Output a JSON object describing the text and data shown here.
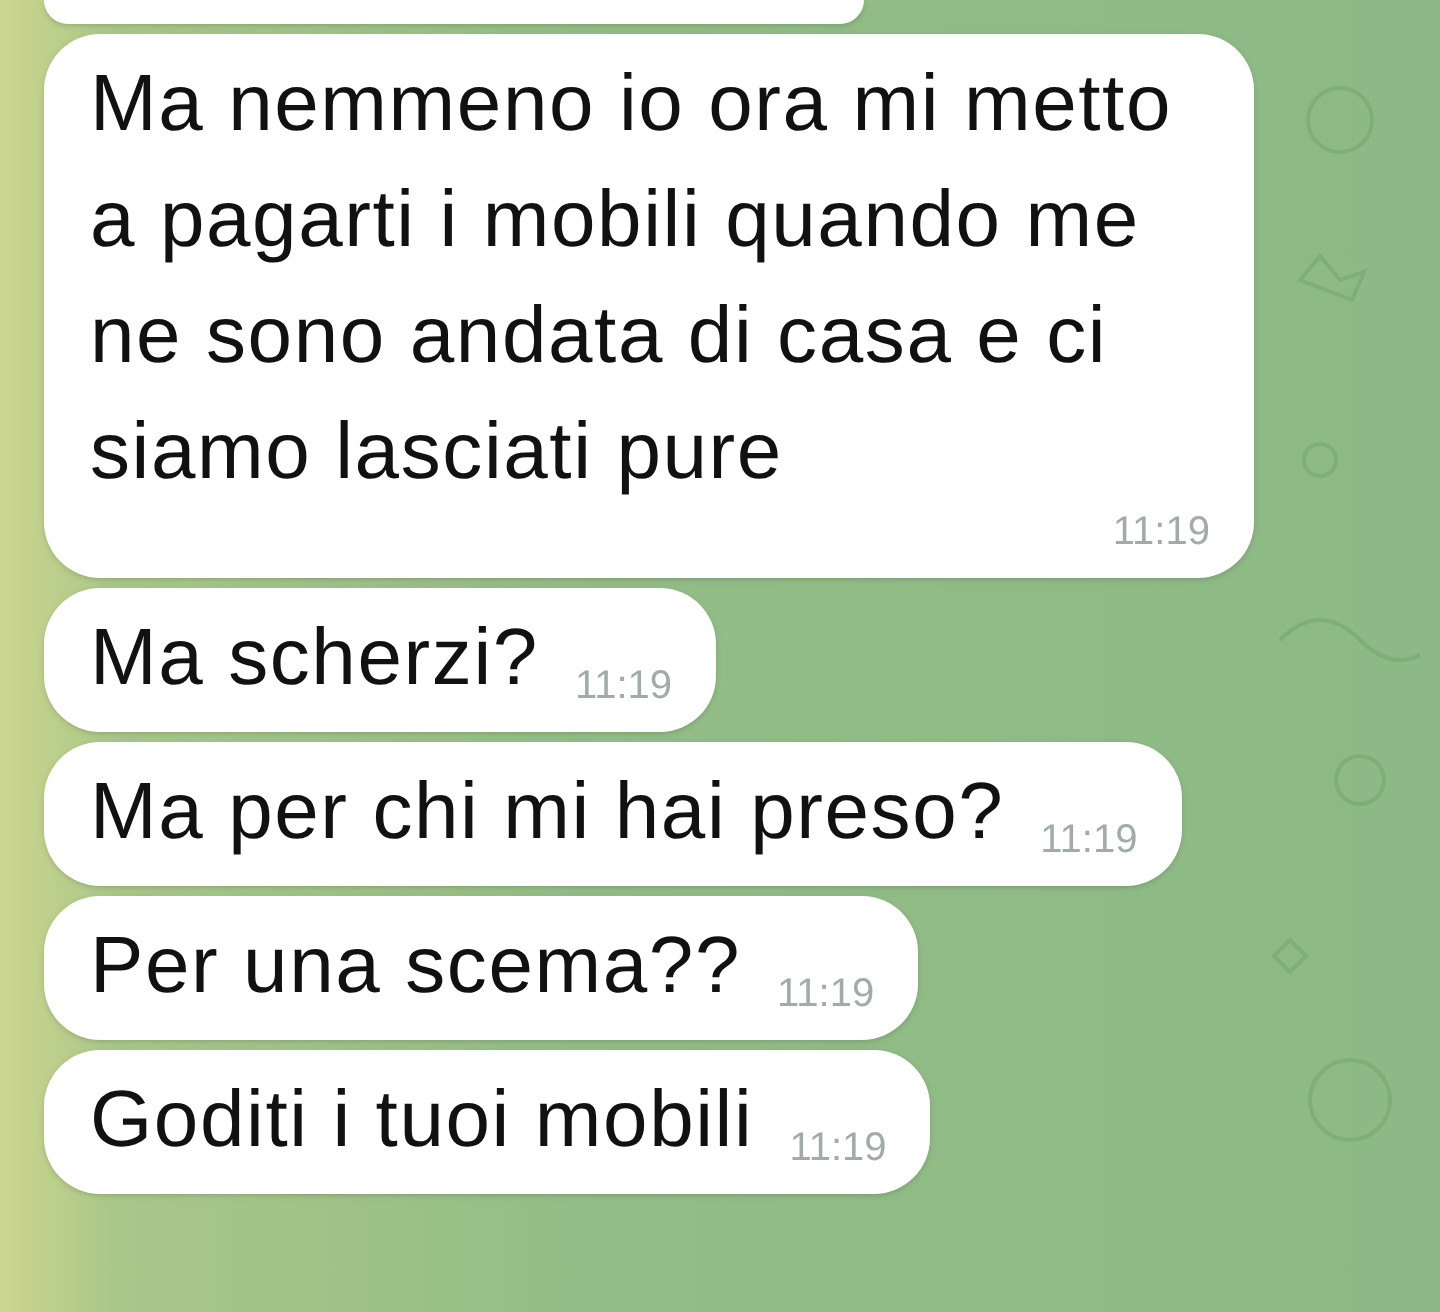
{
  "messages": [
    {
      "cut_off": true
    },
    {
      "cut_off": false,
      "text": "Ma nemmeno io ora mi metto a pagarti i mobili quando me ne sono andata di casa e ci siamo lasciati pure",
      "time": "11:19"
    },
    {
      "cut_off": false,
      "text": "Ma scherzi?",
      "time": "11:19"
    },
    {
      "cut_off": false,
      "text": "Ma per chi mi hai preso?",
      "time": "11:19"
    },
    {
      "cut_off": false,
      "text": "Per una scema??",
      "time": "11:19"
    },
    {
      "cut_off": false,
      "text": "Goditi i tuoi mobili",
      "time": "11:19"
    }
  ]
}
